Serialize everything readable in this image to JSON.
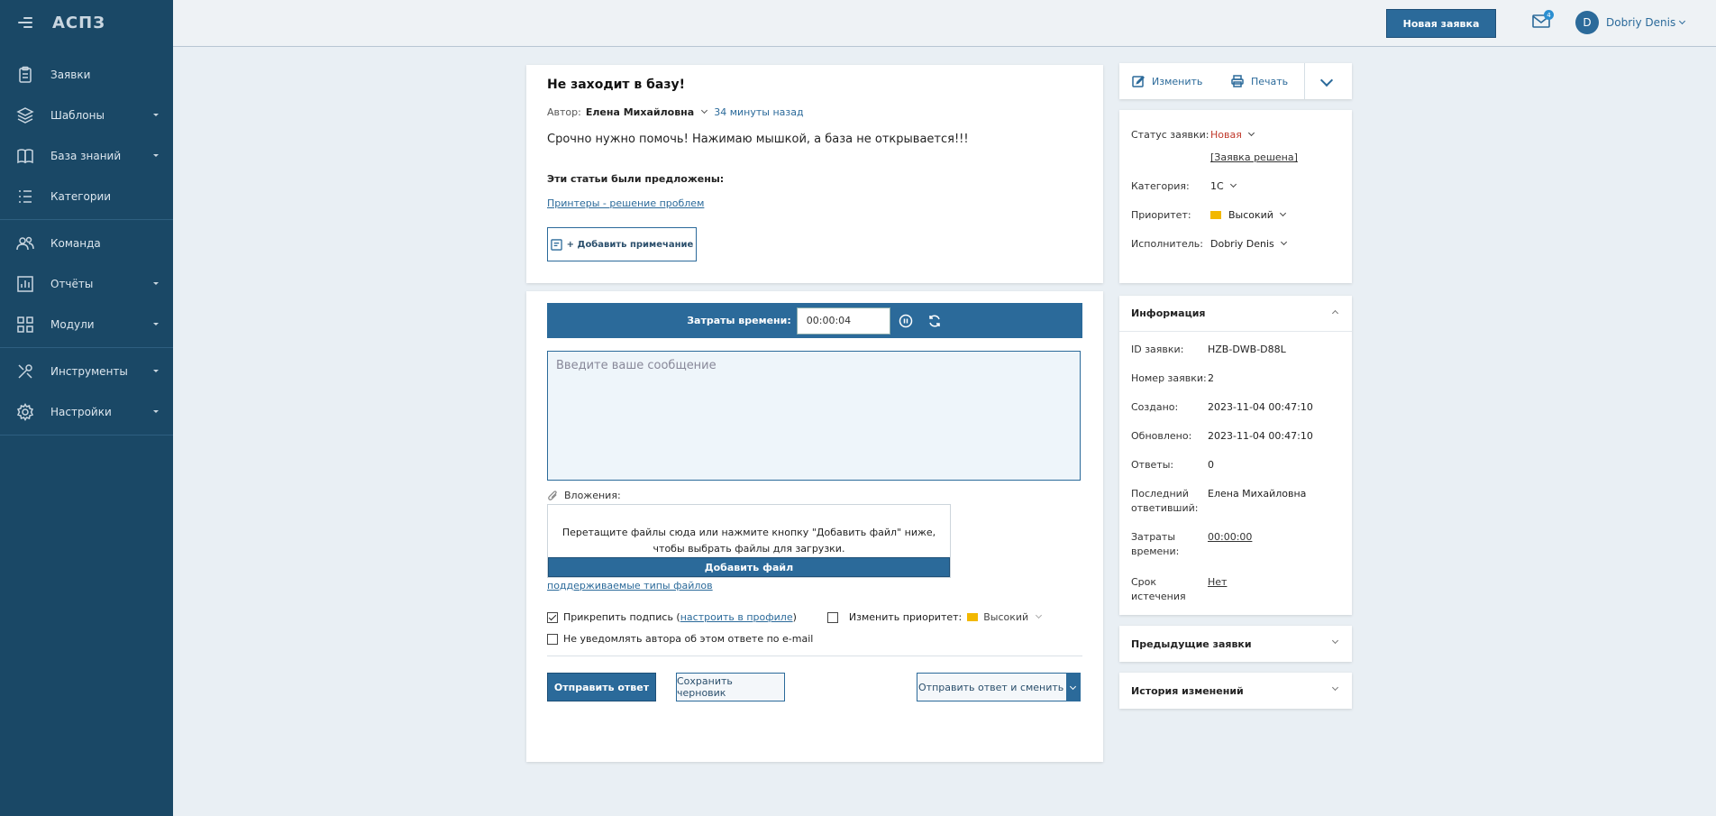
{
  "sidebar": {
    "logo": "АСПЗ",
    "items": [
      {
        "label": "Заявки",
        "icon": "clipboard-icon",
        "caret": false
      },
      {
        "label": "Шаблоны",
        "icon": "layers-icon",
        "caret": true
      },
      {
        "label": "База знаний",
        "icon": "book-icon",
        "caret": true
      },
      {
        "label": "Категории",
        "icon": "list-icon",
        "caret": false
      },
      {
        "label": "Команда",
        "icon": "users-icon",
        "caret": false
      },
      {
        "label": "Отчёты",
        "icon": "bar-chart-icon",
        "caret": true
      },
      {
        "label": "Модули",
        "icon": "grid-icon",
        "caret": true
      },
      {
        "label": "Инструменты",
        "icon": "tools-icon",
        "caret": true
      },
      {
        "label": "Настройки",
        "icon": "gear-icon",
        "caret": true
      }
    ]
  },
  "topbar": {
    "new_ticket": "Новая заявка",
    "mail_count": "4",
    "avatar_letter": "D",
    "user_name": "Dobriy Denis"
  },
  "ticket": {
    "title": "Не заходит в базу!",
    "author_label": "Автор:",
    "author": "Елена Михайловна",
    "ago": "34 минуты назад",
    "body": "Срочно нужно помочь! Нажимаю мышкой, а база не открывается!!!",
    "suggested_title": "Эти статьи были предложены:",
    "suggested_link": "Принтеры - решение проблем",
    "add_note": "+ Добавить примечание"
  },
  "reply": {
    "time_label": "Затраты времени:",
    "time_value": "00:00:04",
    "message_placeholder": "Введите ваше сообщение",
    "attachments_label": "Вложения:",
    "dropzone_text": "Перетащите файлы сюда или нажмите кнопку \"Добавить файл\" ниже, чтобы выбрать файлы для загрузки.",
    "add_file": "Добавить файл",
    "supported_types": "поддерживаемые типы файлов",
    "attach_signature": "Прикрепить подпись (",
    "configure_profile": "настроить в профиле",
    "attach_signature_end": ")",
    "change_priority": "Изменить приоритет:",
    "priority_value": "Высокий",
    "no_notify": "Не уведомлять автора об этом ответе по e-mail",
    "send": "Отправить ответ",
    "save_draft": "Сохранить черновик",
    "send_and_change": "Отправить ответ и сменить статус"
  },
  "tools": {
    "edit": "Изменить",
    "print": "Печать"
  },
  "status": {
    "status_label": "Статус заявки:",
    "status_value": "Новая",
    "resolved_link": "[Заявка решена]",
    "category_label": "Категория:",
    "category_value": "1С",
    "priority_label": "Приоритет:",
    "priority_value": "Высокий",
    "assignee_label": "Исполнитель:",
    "assignee_value": "Dobriy Denis"
  },
  "info": {
    "title": "Информация",
    "rows": [
      {
        "k": "ID заявки:",
        "v": "HZB-DWB-D88L"
      },
      {
        "k": "Номер заявки:",
        "v": "2"
      },
      {
        "k": "Создано:",
        "v": "2023-11-04 00:47:10"
      },
      {
        "k": "Обновлено:",
        "v": "2023-11-04 00:47:10"
      },
      {
        "k": "Ответы:",
        "v": "0"
      },
      {
        "k": "Последний ответивший:",
        "v": "Елена Михайловна"
      },
      {
        "k": "Затраты времени:",
        "v": "00:00:00"
      },
      {
        "k": "Срок истечения",
        "v": "Нет"
      }
    ]
  },
  "previous": {
    "title": "Предыдущие заявки"
  },
  "history": {
    "title": "История изменений"
  },
  "colors": {
    "accent": "#2b6a9a",
    "sidebar": "#1a4866",
    "priority_flag": "#f2b800",
    "status_new": "#c0392b"
  }
}
